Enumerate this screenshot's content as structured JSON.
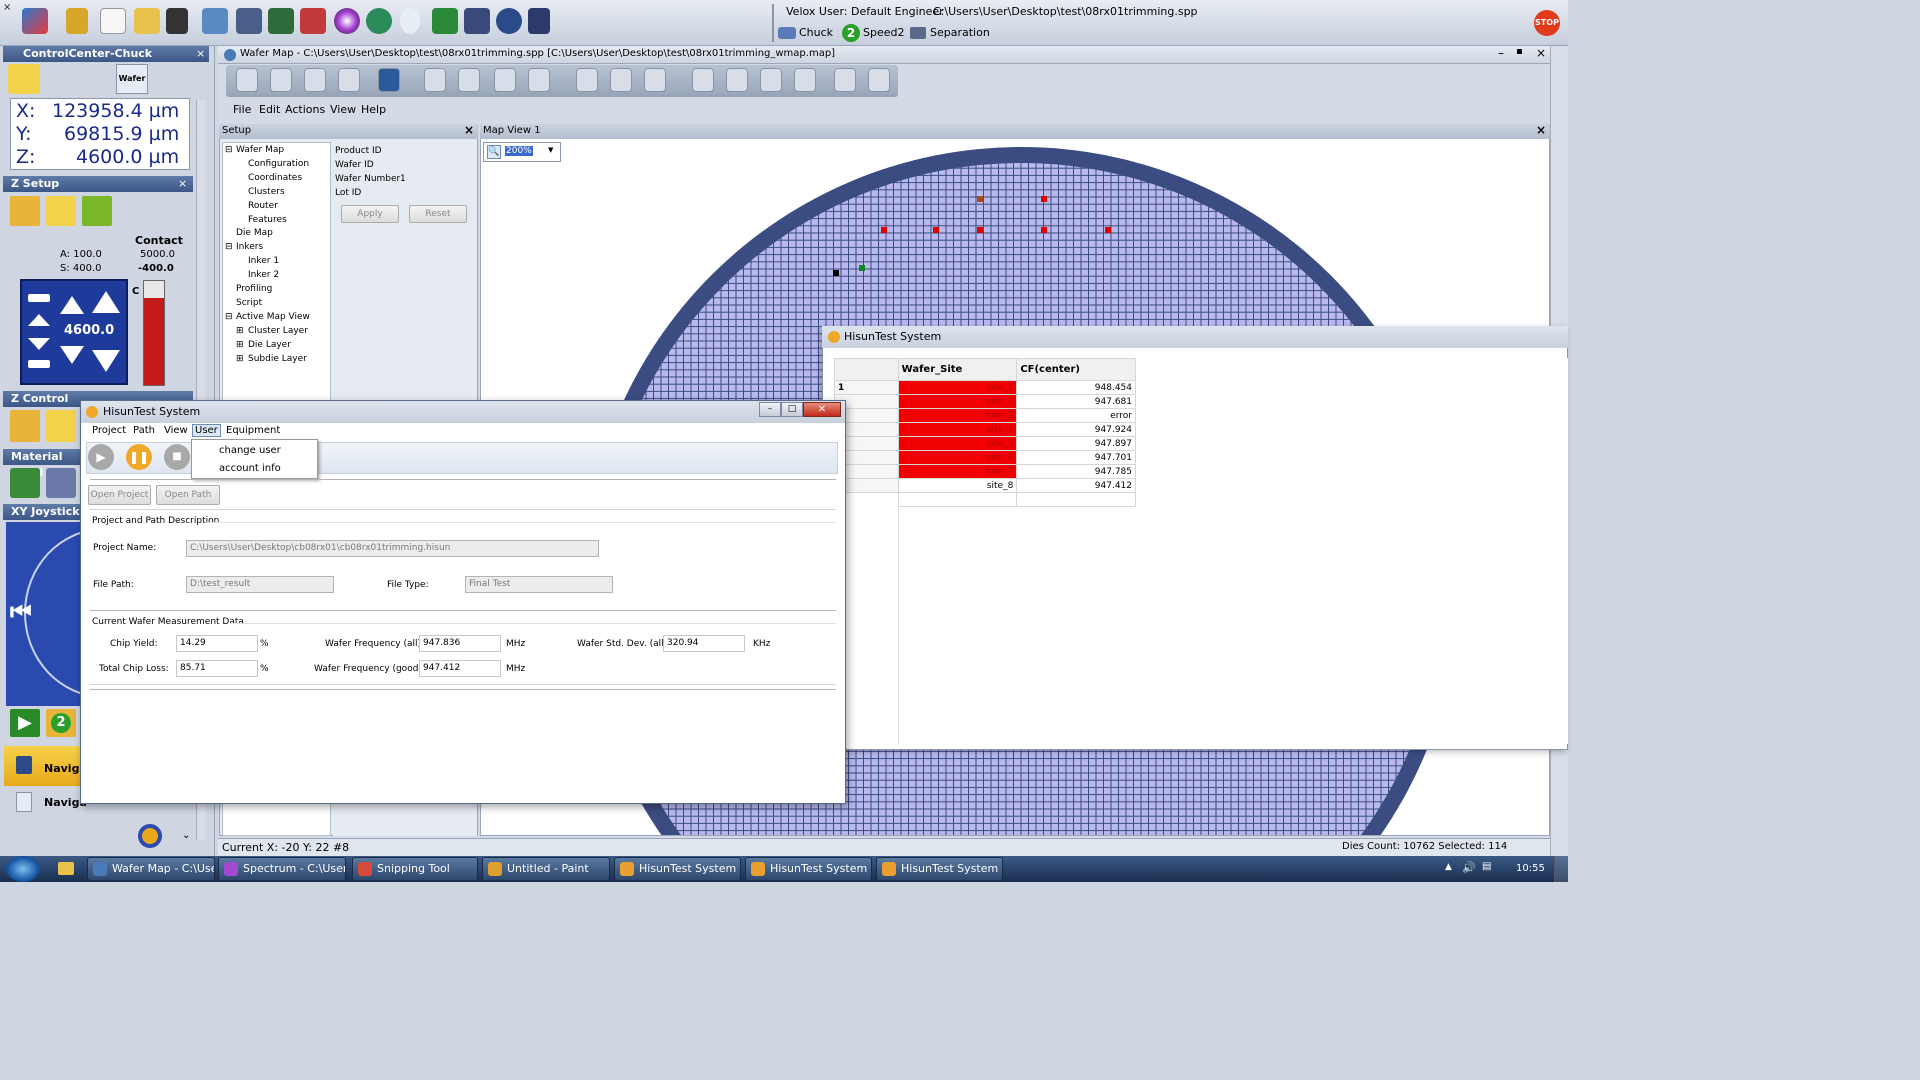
{
  "app": {
    "velox_user": "Velox User: Default Engineer",
    "spp_path": "C:\\Users\\User\\Desktop\\test\\08rx01trimming.spp",
    "chuck_label": "Chuck",
    "speed_label": "Speed2",
    "speed_badge": "2",
    "separation_label": "Separation",
    "stop_label": "STOP"
  },
  "control_center": {
    "title": "ControlCenter-Chuck",
    "wafer_label": "Wafer",
    "x": "X:",
    "x_val": "123958.4 µm",
    "y": "Y:",
    "y_val": "69815.9 µm",
    "z": "Z:",
    "z_val": "4600.0 µm",
    "zsetup_title": "Z Setup",
    "a_val": "A: 100.0",
    "s_val": "S: 400.0",
    "contact_label": "Contact",
    "contact_val": "5000.0",
    "contact_offset": "-400.0",
    "z_display": "4600.0",
    "c_label": "C",
    "zcontrol_title": "Z Control",
    "material_title": "Material Hand",
    "xy_title": "XY Joystick",
    "nav1": "Naviga",
    "nav2": "Naviga",
    "badge2": "2"
  },
  "wafer_map": {
    "title": "Wafer Map - C:\\Users\\User\\Desktop\\test\\08rx01trimming.spp [C:\\Users\\User\\Desktop\\test\\08rx01trimming_wmap.map]",
    "menu": [
      "File",
      "Edit",
      "Actions",
      "View",
      "Help"
    ],
    "setup_title": "Setup",
    "tree": [
      {
        "label": "Wafer Map",
        "indent": 0
      },
      {
        "label": "Configuration",
        "indent": 1
      },
      {
        "label": "Coordinates",
        "indent": 1
      },
      {
        "label": "Clusters",
        "indent": 1
      },
      {
        "label": "Router",
        "indent": 1
      },
      {
        "label": "Features",
        "indent": 1
      },
      {
        "label": "Die Map",
        "indent": 0
      },
      {
        "label": "Inkers",
        "indent": 0
      },
      {
        "label": "Inker 1",
        "indent": 1
      },
      {
        "label": "Inker 2",
        "indent": 1
      },
      {
        "label": "Profiling",
        "indent": 0
      },
      {
        "label": "Script",
        "indent": 0
      },
      {
        "label": "Active Map View",
        "indent": 0
      },
      {
        "label": "Cluster Layer",
        "indent": 1
      },
      {
        "label": "Die Layer",
        "indent": 1
      },
      {
        "label": "Subdie Layer",
        "indent": 1
      }
    ],
    "props": {
      "product_id": "Product ID",
      "wafer_id": "Wafer ID",
      "wafer_number": "Wafer Number",
      "wafer_number_val": "1",
      "lot_id": "Lot ID",
      "apply": "Apply",
      "reset": "Reset"
    },
    "map_view_title": "Map View 1",
    "zoom": "200%",
    "status_current": "Current X: -20 Y: 22 #8",
    "status_dies": "Dies Count: 10762 Selected: 114"
  },
  "hisun_dialog": {
    "title": "HisunTest System",
    "menu": [
      "Project",
      "Path",
      "View",
      "User",
      "Equipment"
    ],
    "dropdown": [
      "change user",
      "account info"
    ],
    "open_project": "Open Project",
    "open_path": "Open Path",
    "desc_header": "Project and Path Description",
    "project_name_label": "Project Name:",
    "project_name_val": "C:\\Users\\User\\Desktop\\cb08rx01\\cb08rx01trimming.hisun",
    "file_path_label": "File Path:",
    "file_path_val": "D:\\test_result",
    "file_type_label": "File Type:",
    "file_type_val": "Final Test",
    "meas_header": "Current Wafer Measurement Data",
    "chip_yield_label": "Chip Yield:",
    "chip_yield_val": "14.29",
    "total_loss_label": "Total Chip Loss:",
    "total_loss_val": "85.71",
    "pct": "%",
    "wf_all_label": "Wafer Frequency (all):",
    "wf_all_val": "947.836",
    "wf_good_label": "Wafer Frequency (good):",
    "wf_good_val": "947.412",
    "mhz": "MHz",
    "std_label": "Wafer Std. Dev. (all):",
    "std_val": "320.94",
    "khz": "KHz"
  },
  "hisun_results": {
    "title": "HisunTest System",
    "col_site": "Wafer_Site",
    "col_cf": "CF(center)",
    "rows": [
      {
        "idx": "1",
        "site": "site_1",
        "cf": "948.454",
        "fail": true
      },
      {
        "idx": "",
        "site": "site_2",
        "cf": "947.681",
        "fail": true
      },
      {
        "idx": "",
        "site": "site_3",
        "cf": "error",
        "fail": true
      },
      {
        "idx": "",
        "site": "site_4",
        "cf": "947.924",
        "fail": true
      },
      {
        "idx": "",
        "site": "site_5",
        "cf": "947.897",
        "fail": true
      },
      {
        "idx": "",
        "site": "site_6",
        "cf": "947.701",
        "fail": true
      },
      {
        "idx": "",
        "site": "site_7",
        "cf": "947.785",
        "fail": true
      },
      {
        "idx": "",
        "site": "site_8",
        "cf": "947.412",
        "fail": false
      }
    ]
  },
  "taskbar": {
    "tabs": [
      {
        "label": "Wafer Map - C:\\User...",
        "color": "#4a7ab8"
      },
      {
        "label": "Spectrum - C:\\Users\\...",
        "color": "#a44ad0"
      },
      {
        "label": "Snipping Tool",
        "color": "#d84a3a"
      },
      {
        "label": "Untitled - Paint",
        "color": "#e0a030"
      },
      {
        "label": "HisunTest System",
        "color": "#e8a030"
      },
      {
        "label": "HisunTest System",
        "color": "#e8a030"
      },
      {
        "label": "HisunTest System",
        "color": "#e8a030"
      }
    ],
    "clock": "10:55"
  },
  "colors": {
    "fail": "#f00000",
    "wafer_ring": "#3b4c82",
    "die": "#b9b9ee"
  }
}
